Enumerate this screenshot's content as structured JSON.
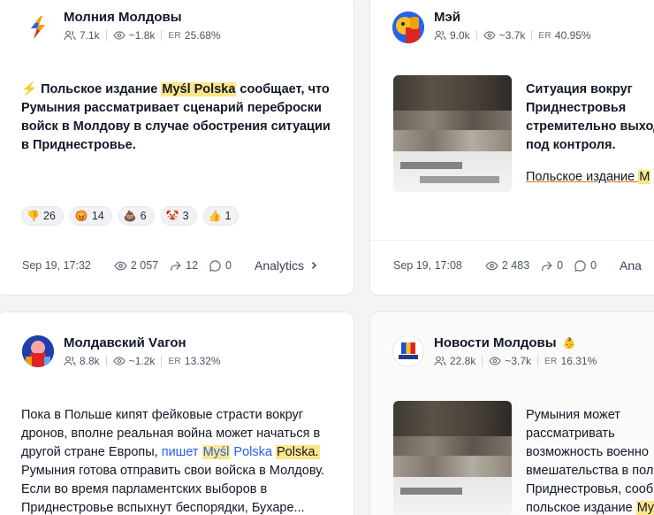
{
  "cards": [
    {
      "channel": "Молния Молдовы",
      "subscribers": "7.1k",
      "views": "~1.8k",
      "er_label": "ER",
      "er": "25.68%",
      "post_pre": "⚡ Польское издание ",
      "post_hl": "Myśl Polska",
      "post_post": " сообщает, что Румыния рассматривает сценарий переброски войск в Молдову в случае обострения ситуации в Приднестровье.",
      "reactions": [
        {
          "emoji": "👎",
          "count": "26"
        },
        {
          "emoji": "😡",
          "count": "14"
        },
        {
          "emoji": "💩",
          "count": "6"
        },
        {
          "emoji": "🤡",
          "count": "3"
        },
        {
          "emoji": "👍",
          "count": "1"
        }
      ],
      "date": "Sep 19, 17:32",
      "view_count": "2 057",
      "shares": "12",
      "comments": "0",
      "analytics": "Analytics"
    },
    {
      "channel": "Мэй",
      "subscribers": "9.0k",
      "views": "~3.7k",
      "er_label": "ER",
      "er": "40.95%",
      "post_lines": [
        "Ситуация вокруг",
        "Приднестровья",
        "стремительно выход",
        "под контроля."
      ],
      "post2_pre": "Польское издание ",
      "post2_hl": "M",
      "date": "Sep 19, 17:08",
      "view_count": "2 483",
      "shares": "0",
      "comments": "0",
      "analytics": "Ana"
    },
    {
      "channel": "Молдавский Vагон",
      "subscribers": "8.8k",
      "views": "~1.2k",
      "er_label": "ER",
      "er": "13.32%",
      "post_a": "Пока в Польше кипят фейковые страсти вокруг дронов, вполне реальная война может начаться в другой стране Европы, ",
      "post_link": "пишет",
      "post_hl": "Myśl",
      "post_link2": "Polska",
      "post_hl2": "Polska.",
      "post_b": " Румыния готова отправить свои войска в Молдову. Если во время парламентских выборов в Приднестровье вспыхнут беспорядки, Бухаре..."
    },
    {
      "channel": "Новости Молдовы",
      "channel_badge": "👶",
      "subscribers": "22.8k",
      "views": "~3.7k",
      "er_label": "ER",
      "er": "16.31%",
      "post_lines": [
        "Румыния может",
        "рассматривать",
        "возможность военно",
        "вмешательства в пол",
        "Приднестровья, сооб"
      ],
      "post_last_pre": "польское издание ",
      "post_last_hl": "My"
    }
  ]
}
